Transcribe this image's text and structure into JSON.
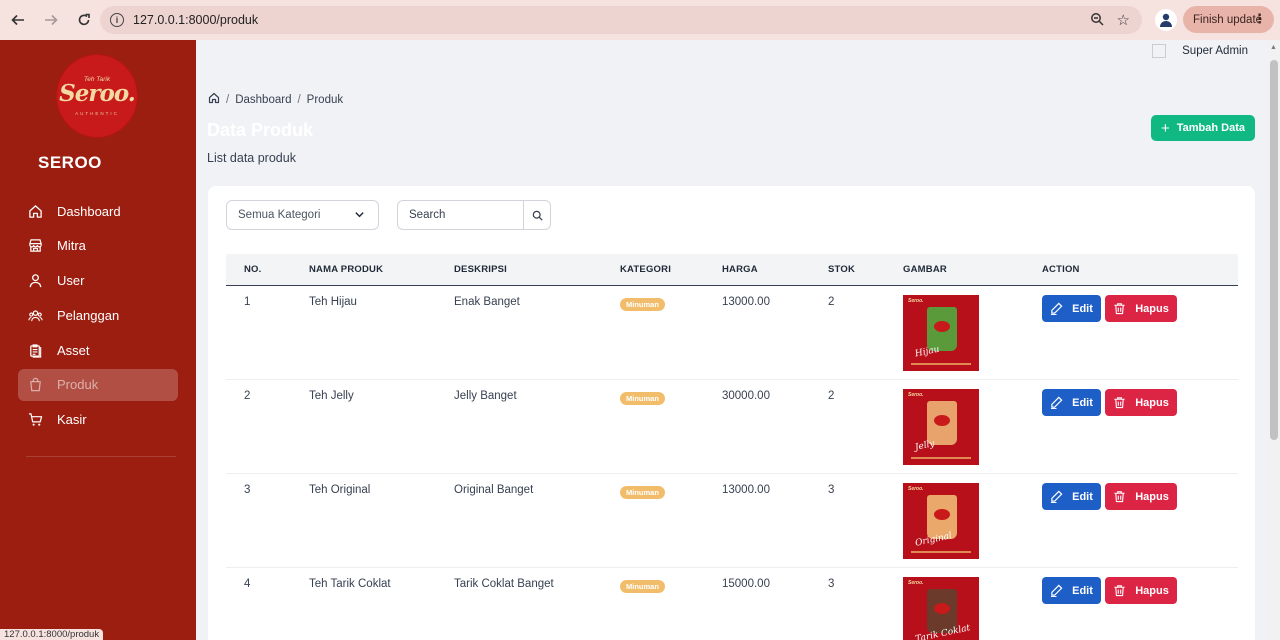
{
  "browser": {
    "url": "127.0.0.1:8000/produk",
    "finish_update": "Finish update",
    "status_url": "127.0.0.1:8000/produk"
  },
  "sidebar": {
    "logo": {
      "small": "Teh Tarik",
      "main": "Seroo.",
      "sub": "AUTHENTIC"
    },
    "brand": "SEROO",
    "items": [
      {
        "label": "Dashboard",
        "icon": "home-icon",
        "active": false
      },
      {
        "label": "Mitra",
        "icon": "store-icon",
        "active": false
      },
      {
        "label": "User",
        "icon": "user-icon",
        "active": false
      },
      {
        "label": "Pelanggan",
        "icon": "users-icon",
        "active": false
      },
      {
        "label": "Asset",
        "icon": "clipboard-icon",
        "active": false
      },
      {
        "label": "Produk",
        "icon": "shopping-bag-icon",
        "active": true
      },
      {
        "label": "Kasir",
        "icon": "shopping-cart-icon",
        "active": false
      }
    ]
  },
  "header": {
    "user_name": "Super Admin"
  },
  "breadcrumb": {
    "items": [
      "Dashboard",
      "Produk"
    ]
  },
  "page": {
    "title": "Data Produk",
    "subtitle": "List data produk",
    "add_button": "Tambah Data"
  },
  "filters": {
    "category_selected": "Semua Kategori",
    "search_placeholder": "Search"
  },
  "table": {
    "headers": [
      "NO.",
      "NAMA PRODUK",
      "DESKRIPSI",
      "KATEGORI",
      "HARGA",
      "STOK",
      "GAMBAR",
      "ACTION"
    ],
    "edit_label": "Edit",
    "delete_label": "Hapus",
    "rows": [
      {
        "no": "1",
        "name": "Teh Hijau",
        "desc": "Enak Banget",
        "category": "Minuman",
        "price": "13000.00",
        "stock": "2",
        "image_label": "Hijau",
        "image_color": "#5a9a3a"
      },
      {
        "no": "2",
        "name": "Teh Jelly",
        "desc": "Jelly Banget",
        "category": "Minuman",
        "price": "30000.00",
        "stock": "2",
        "image_label": "Jelly",
        "image_color": "#e7a36b"
      },
      {
        "no": "3",
        "name": "Teh Original",
        "desc": "Original Banget",
        "category": "Minuman",
        "price": "13000.00",
        "stock": "3",
        "image_label": "Original",
        "image_color": "#eaa86b"
      },
      {
        "no": "4",
        "name": "Teh Tarik Coklat",
        "desc": "Tarik Coklat Banget",
        "category": "Minuman",
        "price": "15000.00",
        "stock": "3",
        "image_label": "Tarik Coklat",
        "image_color": "#6b3a2a"
      }
    ]
  },
  "colors": {
    "sidebar": "#9c1e10",
    "add_button": "#10b981",
    "edit_button": "#1d5ec7",
    "delete_button": "#dc2545",
    "badge": "#f2bd6b"
  }
}
